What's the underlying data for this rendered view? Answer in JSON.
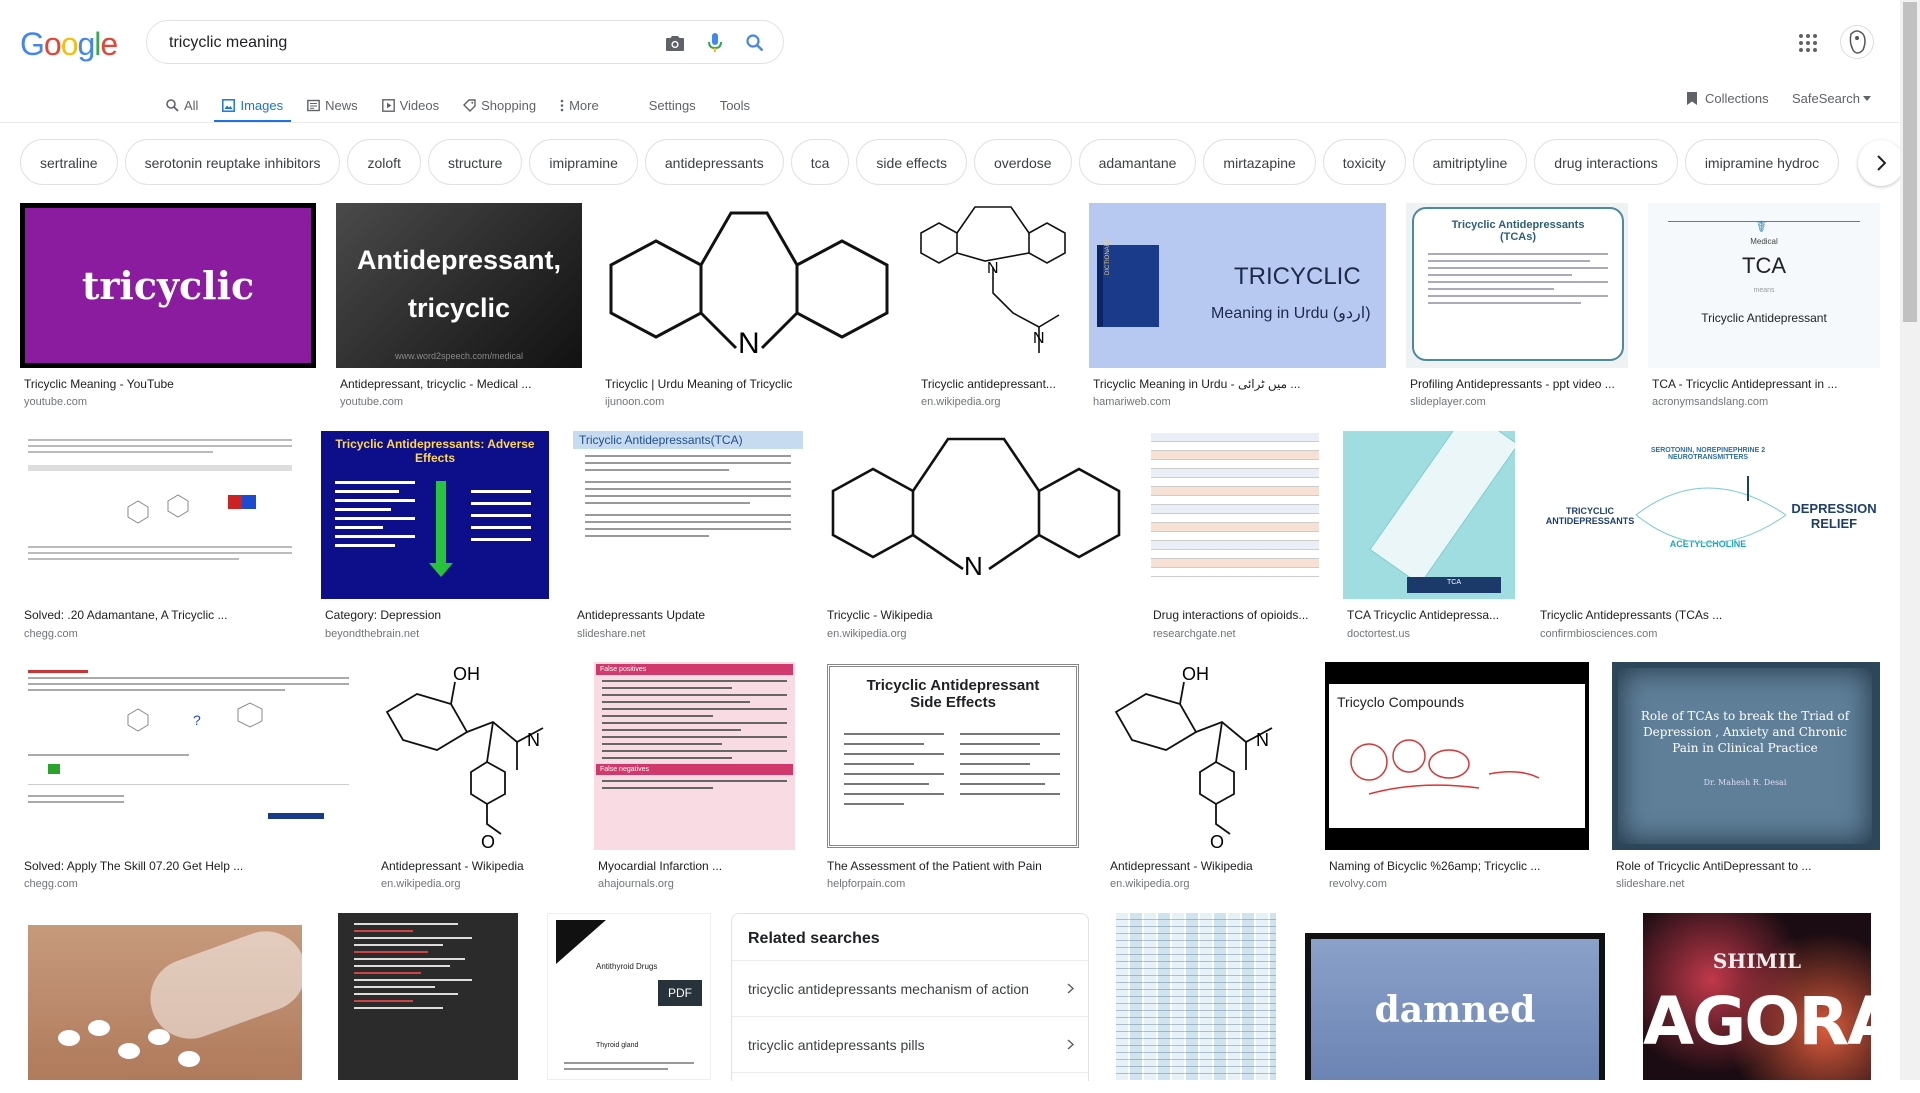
{
  "logo": [
    "G",
    "o",
    "o",
    "g",
    "l",
    "e"
  ],
  "logo_colors": [
    "#4285f4",
    "#ea4335",
    "#fbbc05",
    "#4285f4",
    "#34a853",
    "#ea4335"
  ],
  "search": {
    "value": "tricyclic meaning"
  },
  "nav": {
    "tabs": [
      {
        "label": "All",
        "icon": "search-icon"
      },
      {
        "label": "Images",
        "icon": "image-icon",
        "active": true
      },
      {
        "label": "News",
        "icon": "news-icon"
      },
      {
        "label": "Videos",
        "icon": "video-icon"
      },
      {
        "label": "Shopping",
        "icon": "tag-icon"
      },
      {
        "label": "More",
        "icon": "more-vert-icon"
      }
    ],
    "settings": "Settings",
    "tools": "Tools",
    "collections": "Collections",
    "safesearch": "SafeSearch"
  },
  "chips": [
    "sertraline",
    "serotonin reuptake inhibitors",
    "zoloft",
    "structure",
    "imipramine",
    "antidepressants",
    "tca",
    "side effects",
    "overdose",
    "adamantane",
    "mirtazapine",
    "toxicity",
    "amitriptyline",
    "drug interactions",
    "imipramine hydroc"
  ],
  "thumb_text": {
    "t1": "tricyclic",
    "t2a": "Antidepressant,",
    "t2b": "tricyclic",
    "t2c": "www.word2speech.com/medical",
    "t5a": "TRICYCLIC",
    "t5b": "Meaning in Urdu (اردو)",
    "t5c": "DICTIONARY",
    "t6": "Tricyclic Antidepressants (TCAs)",
    "t7a": "Medical",
    "t7b": "TCA",
    "t7c": "means",
    "t7d": "Tricyclic Antidepressant",
    "t9a": "Tricyclic Antidepressants: Adverse Effects",
    "t10": "Tricyclic Antidepressants(TCA)",
    "t13": "TCA",
    "t14a": "TRICYCLIC ANTIDEPRESSANTS",
    "t14b": "DEPRESSION RELIEF",
    "t14c": "ACETYLCHOLINE",
    "t14d": "SEROTONIN, NOREPINEPHRINE 2 NEUROTRANSMITTERS",
    "t17a": "False positives",
    "t17b": "False negatives",
    "t18a": "Tricyclic Antidepressant",
    "t18b": "Side Effects",
    "t20a": "Tricyclo Compounds",
    "t21a": "Role of TCAs to break the Triad of Depression , Anxiety and Chronic Pain in Clinical Practice",
    "t21b": "Dr. Mahesh R. Desai",
    "t24": "Antithyroid Drugs",
    "t24pdf": "PDF",
    "t24b": "Thyroid gland",
    "t26": "damned",
    "t27": "AGORA",
    "t27b": "SHIMIL"
  },
  "results": [
    {
      "caption": "Tricyclic Meaning - YouTube",
      "source": "youtube.com"
    },
    {
      "caption": "Antidepressant, tricyclic - Medical ...",
      "source": "youtube.com"
    },
    {
      "caption": "Tricyclic | Urdu Meaning of Tricyclic",
      "source": "ijunoon.com"
    },
    {
      "caption": "Tricyclic antidepressant...",
      "source": "en.wikipedia.org"
    },
    {
      "caption": "Tricyclic Meaning in Urdu - میں ٹرائی ...",
      "source": "hamariweb.com"
    },
    {
      "caption": "Profiling Antidepressants - ppt video ...",
      "source": "slideplayer.com"
    },
    {
      "caption": "TCA - Tricyclic Antidepressant in ...",
      "source": "acronymsandslang.com"
    },
    {
      "caption": "Solved: .20 Adamantane, A Tricyclic ...",
      "source": "chegg.com"
    },
    {
      "caption": "Category: Depression",
      "source": "beyondthebrain.net"
    },
    {
      "caption": "Antidepressants Update",
      "source": "slideshare.net"
    },
    {
      "caption": "Tricyclic - Wikipedia",
      "source": "en.wikipedia.org"
    },
    {
      "caption": "Drug interactions of opioids...",
      "source": "researchgate.net"
    },
    {
      "caption": "TCA Tricyclic Antidepressa...",
      "source": "doctortest.us"
    },
    {
      "caption": "Tricyclic Antidepressants (TCAs ...",
      "source": "confirmbiosciences.com"
    },
    {
      "caption": "Solved: Apply The Skill 07.20 Get Help ...",
      "source": "chegg.com"
    },
    {
      "caption": "Antidepressant - Wikipedia",
      "source": "en.wikipedia.org"
    },
    {
      "caption": "Myocardial Infarction ...",
      "source": "ahajournals.org"
    },
    {
      "caption": "The Assessment of the Patient with Pain",
      "source": "helpforpain.com"
    },
    {
      "caption": "Antidepressant - Wikipedia",
      "source": "en.wikipedia.org"
    },
    {
      "caption": "Naming of Bicyclic %26amp; Tricyclic ...",
      "source": "revolvy.com"
    },
    {
      "caption": "Role of Tricyclic AntiDepressant to ...",
      "source": "slideshare.net"
    }
  ],
  "related": {
    "heading": "Related searches",
    "items": [
      "tricyclic antidepressants mechanism of action",
      "tricyclic antidepressants pills"
    ]
  },
  "colors": {
    "accent": "#1a73e8",
    "text": "#202124",
    "muted": "#70757a"
  }
}
